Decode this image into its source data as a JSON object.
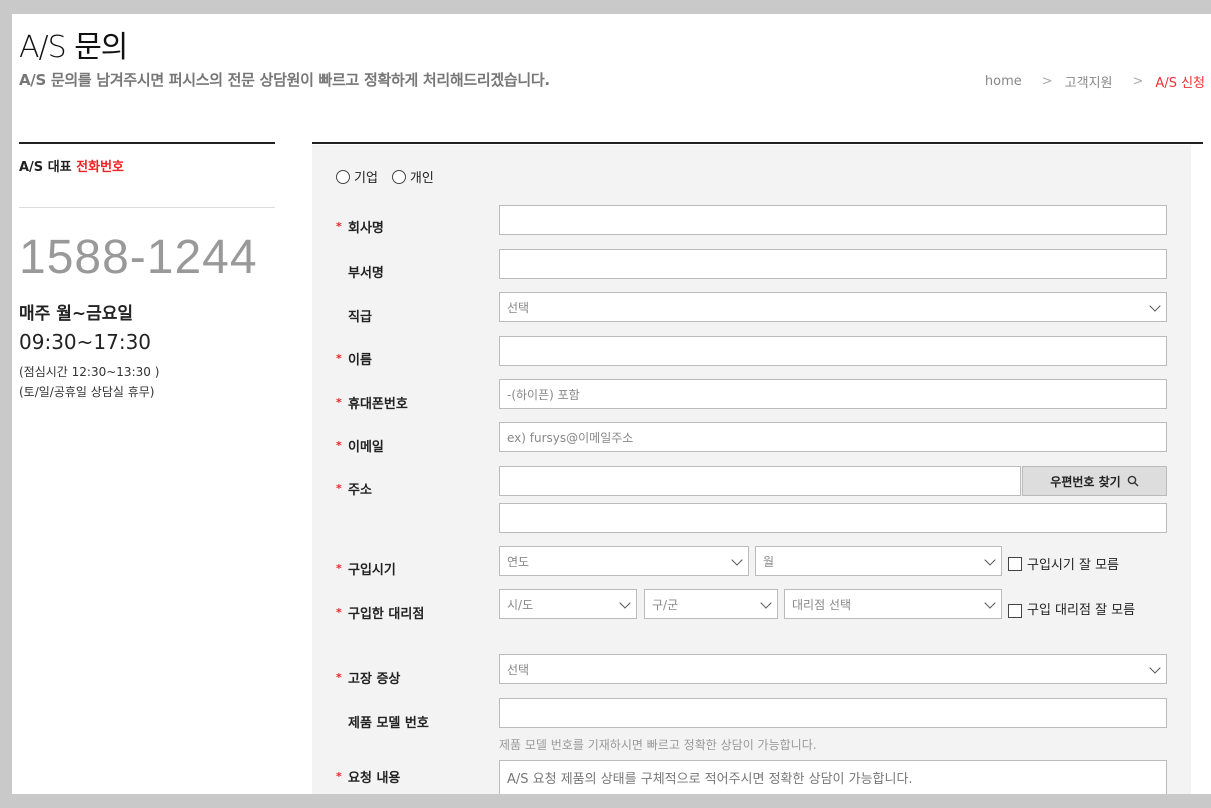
{
  "header": {
    "title": "A/S 문의",
    "subtitle": "A/S 문의를 남겨주시면 퍼시스의 전문 상담원이 빠르고 정확하게 처리해드리겠습니다.",
    "breadcrumb": [
      "home",
      "고객지원",
      "A/S 신청"
    ]
  },
  "contact": {
    "heading_prefix": "A/S 대표",
    "heading_highlight": "전화번호",
    "phone": "1588-1244",
    "days": "매주 월~금요일",
    "hours": "09:30~17:30",
    "lunch": "(점심시간 12:30~13:30 )",
    "closed": "(토/일/공휴일 상담실 휴무)"
  },
  "form": {
    "type_options": [
      "기업",
      "개인"
    ],
    "company_label": "회사명",
    "dept_label": "부서명",
    "position_label": "직급",
    "position_value": "선택",
    "name_label": "이름",
    "mobile_label": "휴대폰번호",
    "mobile_placeholder": "-(하이픈) 포함",
    "email_label": "이메일",
    "email_placeholder": "ex) fursys@이메일주소",
    "address_label": "주소",
    "zip_button": "우편번호 찾기",
    "purchase_date_label": "구입시기",
    "year_value": "연도",
    "month_value": "월",
    "purchase_date_unknown": "구입시기 잘 모름",
    "dealer_label": "구입한 대리점",
    "city_value": "시/도",
    "district_value": "구/군",
    "dealer_value": "대리점 선택",
    "dealer_unknown": "구입 대리점 잘 모름",
    "symptom_label": "고장 증상",
    "symptom_value": "선택",
    "model_label": "제품 모델 번호",
    "model_hint": "제품 모델 번호를 기재하시면 빠르고 정확한 상담이 가능합니다.",
    "request_label": "요청 내용",
    "request_placeholder": "A/S 요청 제품의 상태를 구체적으로 적어주시면 정확한 상담이 가능합니다."
  },
  "icons": {
    "zip_button_icon": "search-icon",
    "select_arrow": "chevron-down-icon"
  },
  "colors": {
    "accent": "#e22222"
  }
}
